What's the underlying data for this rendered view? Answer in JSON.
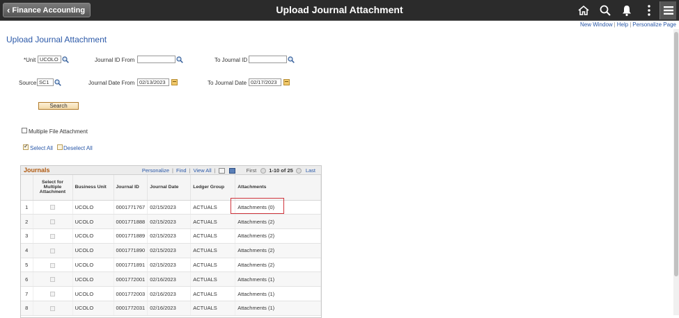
{
  "header": {
    "back_label": "Finance Accounting",
    "title": "Upload Journal Attachment"
  },
  "toplinks": {
    "new_window": "New Window",
    "help": "Help",
    "personalize_page": "Personalize Page"
  },
  "page_title": "Upload Journal Attachment",
  "form": {
    "unit_label": "*Unit",
    "unit_value": "UCOLO",
    "journal_id_from_label": "Journal ID From",
    "journal_id_from_value": "",
    "to_journal_id_label": "To Journal ID",
    "to_journal_id_value": "",
    "source_label": "Source",
    "source_value": "SC1",
    "journal_date_from_label": "Journal Date From",
    "journal_date_from_value": "02/13/2023",
    "to_journal_date_label": "To Journal Date",
    "to_journal_date_value": "02/17/2023",
    "search_label": "Search",
    "multiple_file_label": "Multiple File Attachment",
    "select_all_label": "Select All",
    "deselect_all_label": "Deselect All"
  },
  "grid": {
    "title": "Journals",
    "personalize": "Personalize",
    "find": "Find",
    "view_all": "View All",
    "first": "First",
    "range": "1-10 of 25",
    "last": "Last",
    "columns": [
      "Select for Multiple Attachment",
      "Business Unit",
      "Journal ID",
      "Journal Date",
      "Ledger Group",
      "Attachments"
    ],
    "rows": [
      {
        "n": "1",
        "unit": "UCOLO",
        "jid": "0001771767",
        "date": "02/15/2023",
        "ledger": "ACTUALS",
        "att": "Attachments (0)"
      },
      {
        "n": "2",
        "unit": "UCOLO",
        "jid": "0001771888",
        "date": "02/15/2023",
        "ledger": "ACTUALS",
        "att": "Attachments (2)"
      },
      {
        "n": "3",
        "unit": "UCOLO",
        "jid": "0001771889",
        "date": "02/15/2023",
        "ledger": "ACTUALS",
        "att": "Attachments (2)"
      },
      {
        "n": "4",
        "unit": "UCOLO",
        "jid": "0001771890",
        "date": "02/15/2023",
        "ledger": "ACTUALS",
        "att": "Attachments (2)"
      },
      {
        "n": "5",
        "unit": "UCOLO",
        "jid": "0001771891",
        "date": "02/15/2023",
        "ledger": "ACTUALS",
        "att": "Attachments (2)"
      },
      {
        "n": "6",
        "unit": "UCOLO",
        "jid": "0001772001",
        "date": "02/16/2023",
        "ledger": "ACTUALS",
        "att": "Attachments (1)"
      },
      {
        "n": "7",
        "unit": "UCOLO",
        "jid": "0001772003",
        "date": "02/16/2023",
        "ledger": "ACTUALS",
        "att": "Attachments (1)"
      },
      {
        "n": "8",
        "unit": "UCOLO",
        "jid": "0001772031",
        "date": "02/16/2023",
        "ledger": "ACTUALS",
        "att": "Attachments (1)"
      }
    ]
  },
  "colors": {
    "header_bg": "#2b2b2b",
    "link": "#2a58a8",
    "grid_title": "#b05a10",
    "highlight": "#d0343c"
  }
}
